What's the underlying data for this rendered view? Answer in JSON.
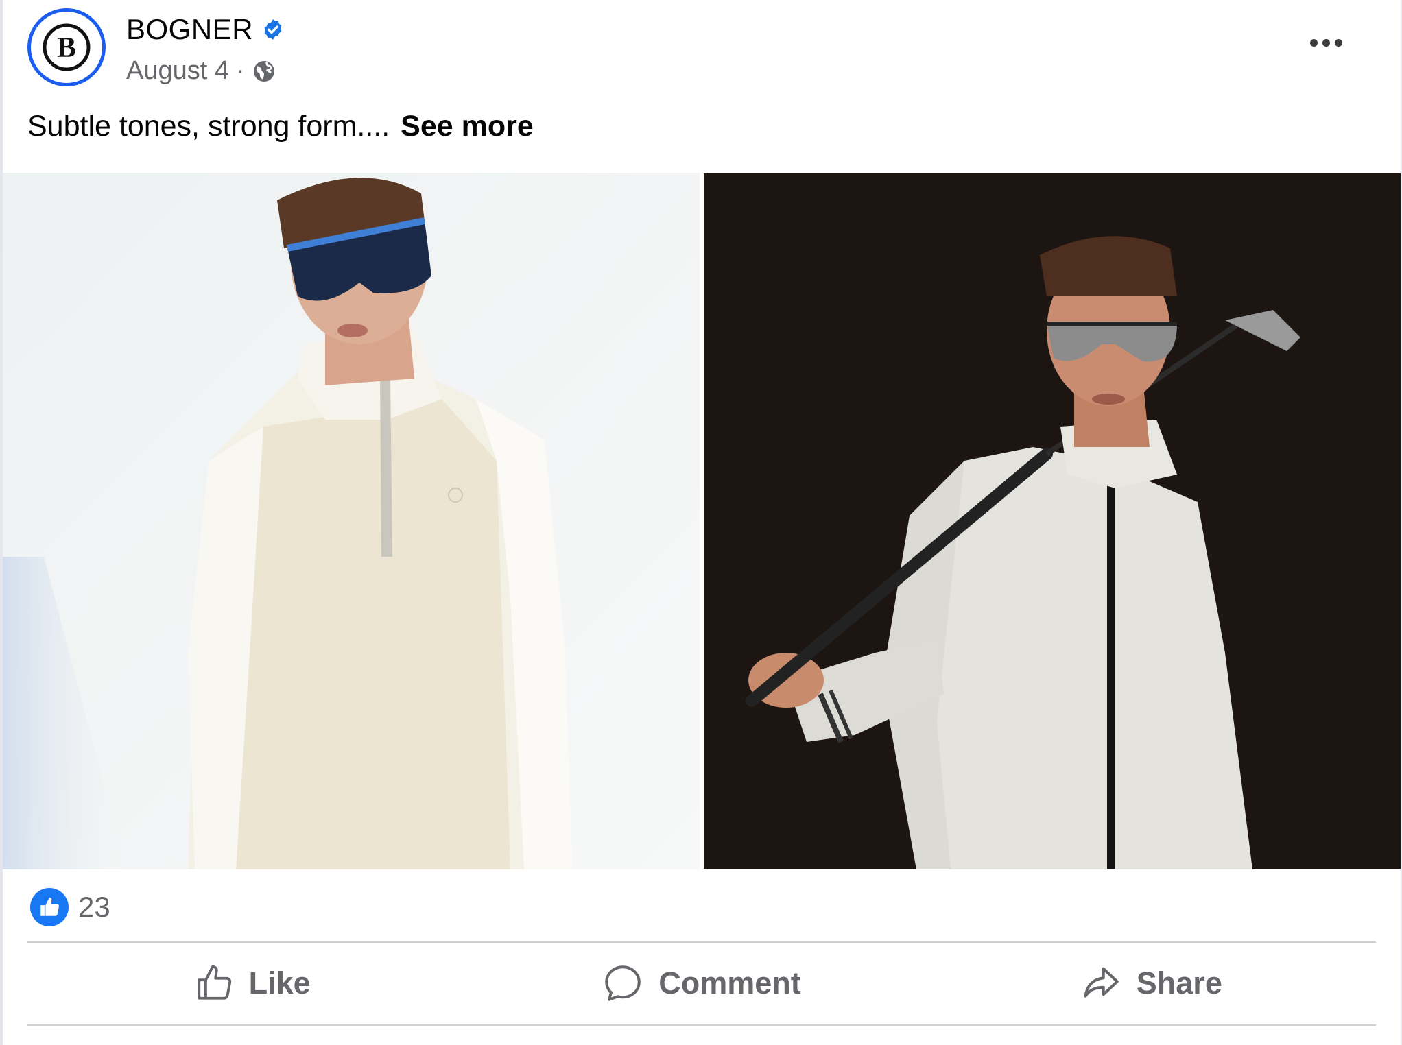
{
  "post": {
    "author": {
      "name": "BOGNER",
      "avatar_letter": "B",
      "verified": true,
      "verified_icon": "verified-badge-icon",
      "verified_color": "#1b74e4",
      "avatar_ring_color": "#1b5cf1"
    },
    "meta": {
      "date": "August 4",
      "separator": "·",
      "audience_icon": "globe-icon"
    },
    "more_icon": "more-horizontal-icon",
    "caption": {
      "text": "Subtle tones, strong form....",
      "see_more": "See more"
    },
    "media": [
      {
        "name": "photo-left",
        "description_icon": "photo"
      },
      {
        "name": "photo-right",
        "description_icon": "photo"
      }
    ],
    "reactions": {
      "icon": "like-reaction-icon",
      "count": "23",
      "color": "#1877f2"
    },
    "actions": [
      {
        "key": "like",
        "label": "Like",
        "icon": "thumbs-up-icon"
      },
      {
        "key": "comment",
        "label": "Comment",
        "icon": "comment-icon"
      },
      {
        "key": "share",
        "label": "Share",
        "icon": "share-icon"
      }
    ]
  }
}
